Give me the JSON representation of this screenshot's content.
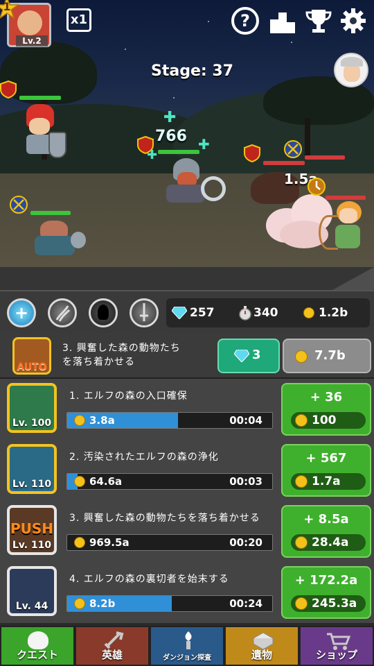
{
  "top": {
    "player_rank": "1",
    "avatar_level": "Lv.2",
    "speed": "x1",
    "stage": "Stage: 37"
  },
  "battle": {
    "heal_number": "766",
    "damage_number": "1.5a"
  },
  "resources": {
    "diamonds": "257",
    "stopwatch": "340",
    "gold": "1.2b"
  },
  "current_quest": {
    "icon_label": "AUTO",
    "title_line1": "3. 興奮した森の動物たち",
    "title_line2": "を落ち着かせる",
    "gem_cost": "3",
    "gold_cost": "7.7b"
  },
  "quests": [
    {
      "title": "1. エルフの森の入口確保",
      "level": "Lv. 100",
      "cost": "3.8a",
      "time": "00:04",
      "progress": 0.54,
      "increase": "+ 36",
      "upgrade_price": "100",
      "icon_color": "#2f7a4a"
    },
    {
      "title": "2. 汚染されたエルフの森の浄化",
      "level": "Lv. 110",
      "cost": "64.6a",
      "time": "00:03",
      "progress": 0.05,
      "increase": "+ 567",
      "upgrade_price": "1.7a",
      "icon_color": "#2a6a86"
    },
    {
      "title": "3. 興奮した森の動物たちを落ち着かせる",
      "level": "Lv. 110",
      "cost": "969.5a",
      "time": "00:20",
      "progress": 0.0,
      "increase": "+ 8.5a",
      "upgrade_price": "28.4a",
      "icon_color": "#5a3a24",
      "push_label": "PUSH"
    },
    {
      "title": "4. エルフの森の裏切者を始末する",
      "level": "Lv. 44",
      "cost": "8.2b",
      "time": "00:24",
      "progress": 0.51,
      "increase": "+ 172.2a",
      "upgrade_price": "245.3a",
      "icon_color": "#2d3b5a"
    }
  ],
  "nav": {
    "tabs": [
      {
        "label": "クエスト",
        "color": "#3aa52a"
      },
      {
        "label": "英雄",
        "color": "#8a3a2a"
      },
      {
        "label": "ダンジョン探査",
        "color": "#2a5a8a"
      },
      {
        "label": "遺物",
        "color": "#c08a1a"
      },
      {
        "label": "ショップ",
        "color": "#6a3a8a"
      }
    ]
  }
}
